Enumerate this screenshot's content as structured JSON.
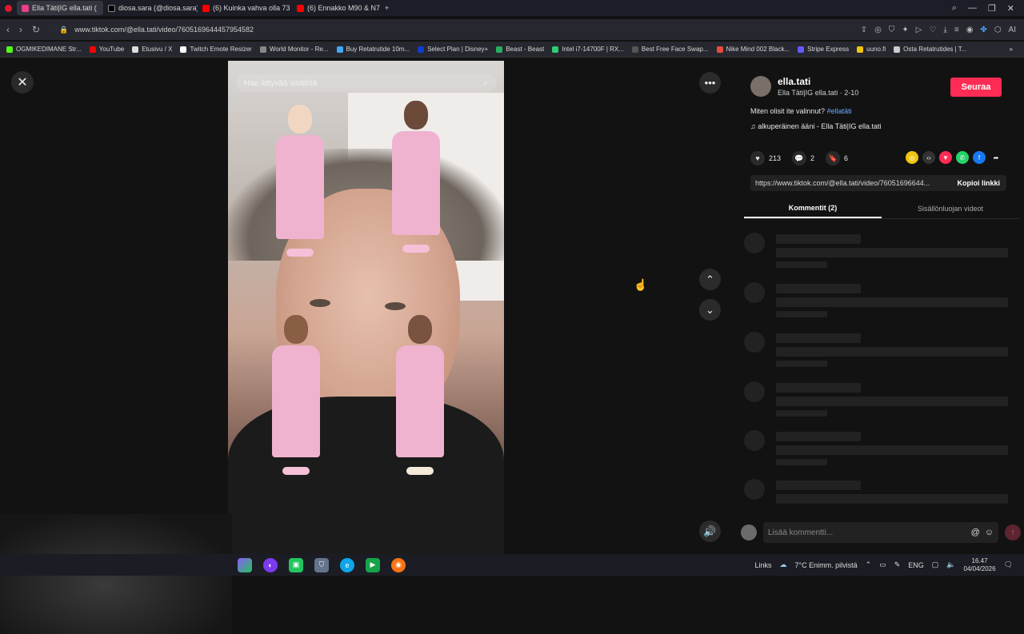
{
  "browser": {
    "tabs": [
      {
        "label": "Ella Täti|IG ella.tati (",
        "color": "#e83e8c",
        "active": true
      },
      {
        "label": "diosa.sara (@diosa.sara) |",
        "color": "#000000",
        "active": false
      },
      {
        "label": "(6) Kuinka vahva olla 73 k",
        "color": "#ff0000",
        "active": false
      },
      {
        "label": "(6) Ennakko M90 & N73 -",
        "color": "#ff0000",
        "active": false
      }
    ],
    "url": "www.tiktok.com/@ella.tati/video/7605169644457954582",
    "bookmarks": [
      {
        "label": "OGMIKEDIMANE Str...",
        "color": "#53fc18"
      },
      {
        "label": "YouTube",
        "color": "#ff0000"
      },
      {
        "label": "Etusivu / X",
        "color": "#dddddd"
      },
      {
        "label": "Twitch Emote Resizer",
        "color": "#ffffff"
      },
      {
        "label": "World Monitor - Re...",
        "color": "#888888"
      },
      {
        "label": "Buy Retatrutide 10m...",
        "color": "#3fa9f5"
      },
      {
        "label": "Select Plan | Disney+",
        "color": "#113ccf"
      },
      {
        "label": "Beast - Beast",
        "color": "#27ae60"
      },
      {
        "label": "Intel i7-14700F | RX...",
        "color": "#2ecc71"
      },
      {
        "label": "Best Free Face Swap...",
        "color": "#555555"
      },
      {
        "label": "Nike Mind 002 Black...",
        "color": "#e74c3c"
      },
      {
        "label": "Stripe Express",
        "color": "#635bff"
      },
      {
        "label": "uuno.fi",
        "color": "#f1c40f"
      },
      {
        "label": "Osta Retatrutides | T...",
        "color": "#cccccc"
      }
    ]
  },
  "video": {
    "search_placeholder": "Hae liittyvää sisältöä"
  },
  "post": {
    "username": "ella.tati",
    "subtitle": "Ella Täti|IG ella.tati · 2-10",
    "follow_label": "Seuraa",
    "description": "Miten olisit ite valinnut?",
    "hashtag": "#ellatäti",
    "sound": "alkuperäinen ääni - Ella Täti|IG ella.tati",
    "likes": "213",
    "comments": "2",
    "saves": "6",
    "link": "https://www.tiktok.com/@ella.tati/video/76051696644...",
    "copy_label": "Kopioi linkki",
    "tab_comments": "Kommentit (2)",
    "tab_creator": "Sisällönluojan videot",
    "comment_placeholder": "Lisää kommentti..."
  },
  "taskbar": {
    "links_label": "Links",
    "weather": "7°C  Enimm. pilvistä",
    "lang": "ENG",
    "time": "16.47",
    "date": "04/04/2026"
  }
}
